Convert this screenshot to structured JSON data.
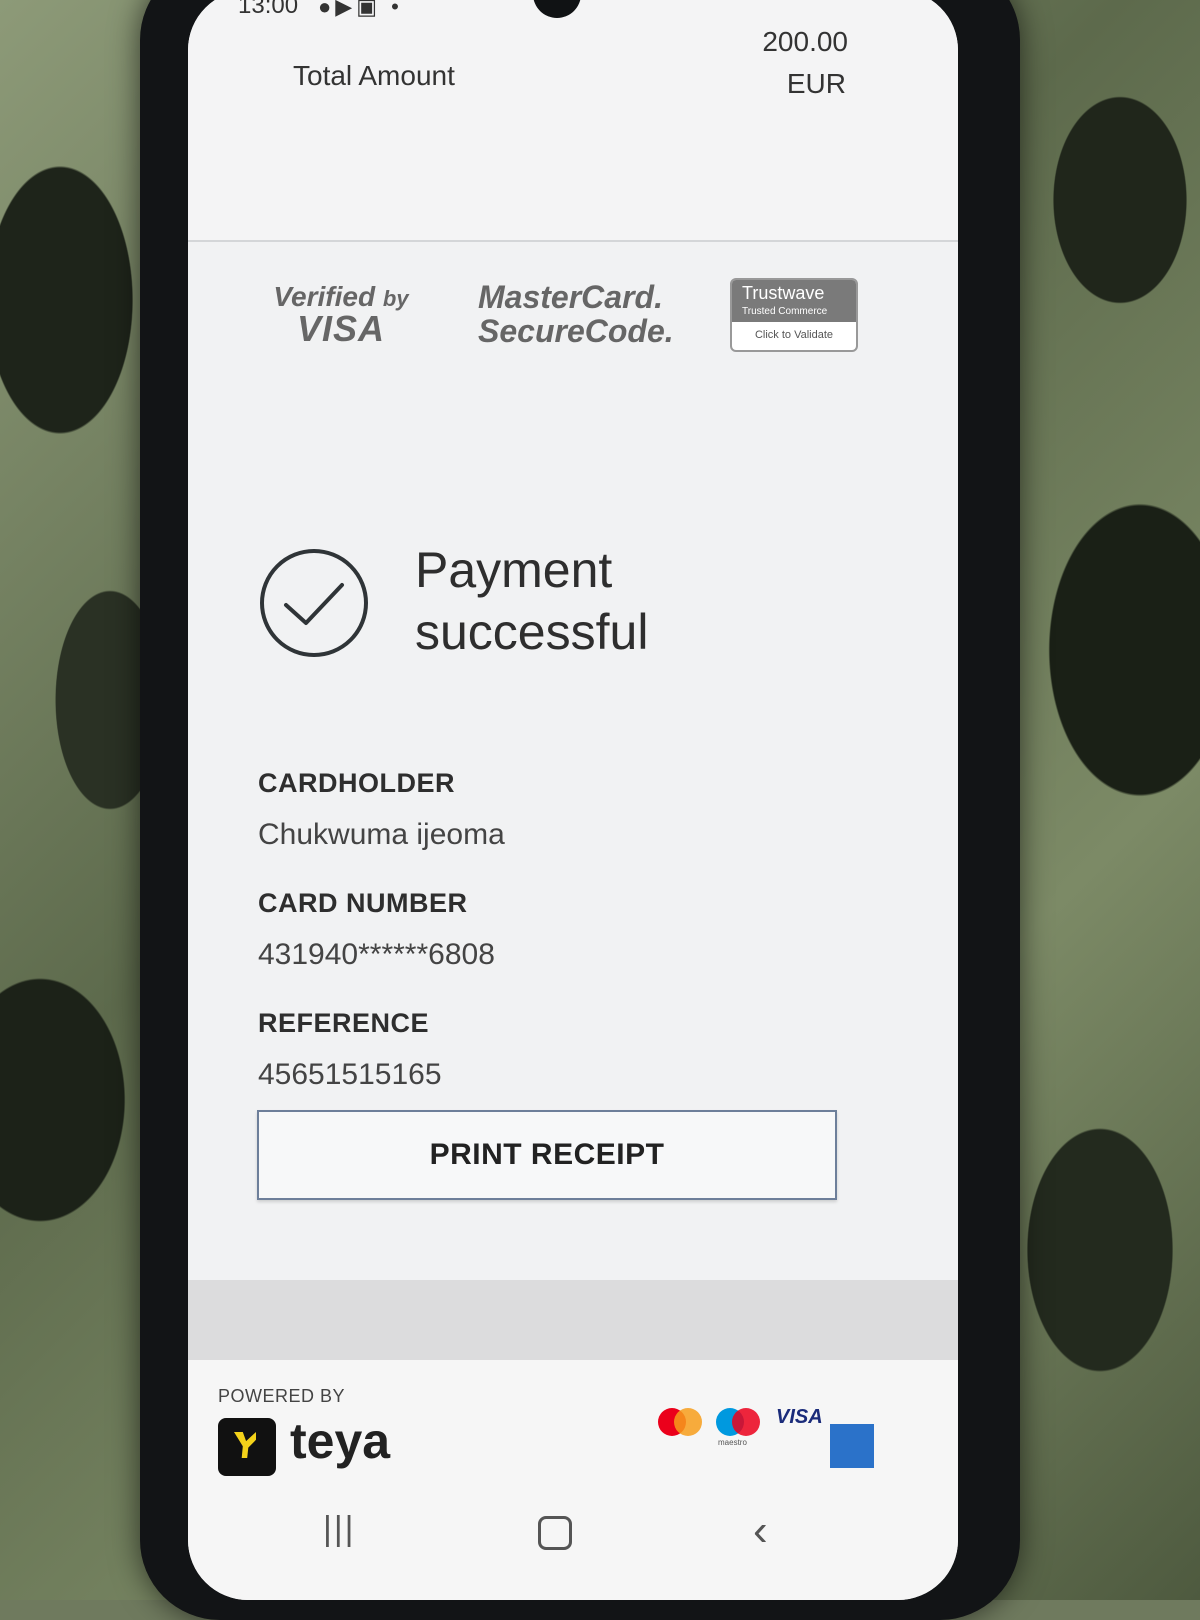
{
  "status_bar": {
    "time": "13:00"
  },
  "summary": {
    "total_label": "Total Amount",
    "amount": "200.00",
    "currency": "EUR"
  },
  "security_badges": {
    "visa_line1": "Verified",
    "visa_line1b": "by",
    "visa_line2": "VISA",
    "mastercard_line1": "MasterCard.",
    "mastercard_line2": "SecureCode.",
    "trustwave_title": "Trustwave",
    "trustwave_sub": "Trusted Commerce",
    "trustwave_action": "Click to Validate"
  },
  "result": {
    "line1": "Payment",
    "line2": "successful",
    "icon": "check-circle-icon"
  },
  "details": {
    "cardholder_label": "CARDHOLDER",
    "cardholder_value": "Chukwuma ijeoma",
    "card_number_label": "CARD NUMBER",
    "card_number_value": "431940******6808",
    "reference_label": "REFERENCE",
    "reference_value": "45651515165"
  },
  "actions": {
    "print_receipt": "PRINT RECEIPT"
  },
  "footer": {
    "powered_by": "POWERED BY",
    "brand": "teya",
    "visa_mark": "VISA",
    "maestro_caption": "maestro"
  },
  "colors": {
    "button_border": "#6d7f9a",
    "mastercard_red": "#eb001b",
    "mastercard_orange": "#f79e1b",
    "maestro_blue": "#0099df",
    "amex_blue": "#2b72c9"
  }
}
